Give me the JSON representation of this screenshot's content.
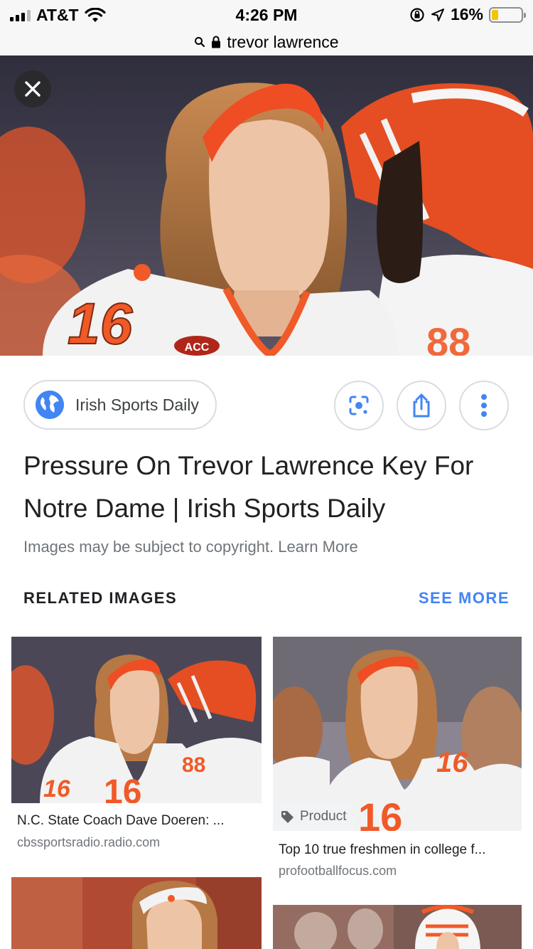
{
  "status_bar": {
    "carrier": "AT&T",
    "time": "4:26 PM",
    "battery_percent": "16%",
    "battery_level": 0.16,
    "battery_color": "#f2c500"
  },
  "url_bar": {
    "query": "trevor lawrence"
  },
  "hero_image": {
    "jersey_number": "16",
    "patch_text": "ACC",
    "teammate_number": "88"
  },
  "source": {
    "name": "Irish Sports Daily",
    "icon": "globe-icon"
  },
  "actions": {
    "lens_icon": "google-lens-icon",
    "share_icon": "share-icon",
    "more_icon": "more-vert-icon"
  },
  "result": {
    "title": "Pressure On Trevor Lawrence Key For Notre Dame | Irish Sports Daily",
    "copyright_notice": "Images may be subject to copyright. Learn More"
  },
  "related": {
    "header": "RELATED IMAGES",
    "see_more": "SEE MORE",
    "items": [
      {
        "title": "N.C. State Coach Dave Doeren: ...",
        "domain": "cbssportsradio.radio.com",
        "jersey_number": "16",
        "teammate_number": "88"
      },
      {
        "title": "Top 10 true freshmen in college f...",
        "domain": "profootballfocus.com",
        "badge": "Product",
        "jersey_number": "16"
      }
    ]
  },
  "colors": {
    "accent": "#4285f4",
    "clemson_orange": "#f05a28",
    "secondary_text": "#70757a"
  }
}
